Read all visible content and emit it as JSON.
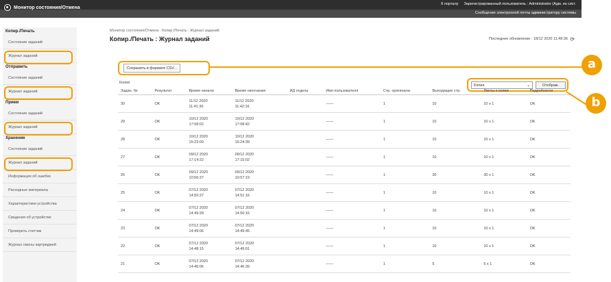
{
  "header": {
    "title": "Монитор состояния/Отмена",
    "links": [
      "К порталу",
      "Зарегистрированный пользователь : Administrator (Адм. из сист.",
      ""
    ],
    "mail_link": "Сообщение электронной почты администратору системы"
  },
  "sidebar": {
    "sections": [
      {
        "title": "Копир./Печать",
        "items": [
          {
            "label": "Состояние заданий",
            "highlight": false
          },
          {
            "label": "Журнал заданий",
            "highlight": true
          }
        ]
      },
      {
        "title": "Отправить",
        "items": [
          {
            "label": "Состояние заданий",
            "highlight": false
          },
          {
            "label": "Журнал заданий",
            "highlight": true
          }
        ]
      },
      {
        "title": "Прием",
        "items": [
          {
            "label": "Состояние заданий",
            "highlight": false
          },
          {
            "label": "Журнал заданий",
            "highlight": true
          }
        ]
      },
      {
        "title": "Хранение",
        "items": [
          {
            "label": "Состояние заданий",
            "highlight": false
          },
          {
            "label": "Журнал заданий",
            "highlight": true
          },
          {
            "label": "Информация об ошибке",
            "highlight": false
          },
          {
            "label": "Расходные материалы",
            "highlight": false
          },
          {
            "label": "Характеристики устройства",
            "highlight": false
          },
          {
            "label": "Сведения об устройстве",
            "highlight": false
          },
          {
            "label": "Проверить счетчик",
            "highlight": false
          },
          {
            "label": "Журнал смены картриджей",
            "highlight": false
          }
        ]
      }
    ]
  },
  "main": {
    "breadcrumb": "Монитор состояния/Отмена : Копир./Печать : Журнал заданий",
    "title": "Копир./Печать : Журнал заданий",
    "last_update": "Последнее обновление : 18/12 2020 11:49:36",
    "csv_button": "Сохранить в формате CSV...",
    "section_label": "Копия",
    "filter_value": "Копия",
    "display_button": "Отображ."
  },
  "table": {
    "columns": [
      "Задан. №",
      "Результат",
      "Время начала",
      "Время окончания",
      "ИД отдела",
      "Имя пользователя",
      "Стр. оригинала",
      "Выходящие стр.",
      "Листы x копии",
      "Подробности"
    ],
    "rows": [
      [
        "30",
        "OK",
        "11/12 2020\n11:41:36",
        "11/12 2020\n11:42:16",
        "",
        "——",
        "1",
        "10",
        "10 x 1",
        "OK"
      ],
      [
        "29",
        "OK",
        "10/12 2020\n17:08:02",
        "10/12 2020\n17:08:42",
        "",
        "——",
        "1",
        "10",
        "10 x 1",
        "OK"
      ],
      [
        "28",
        "OK",
        "10/12 2020\n15:23:00",
        "10/12 2020\n15:24:39",
        "",
        "——",
        "1",
        "10",
        "10 x 1",
        "OK"
      ],
      [
        "27",
        "OK",
        "09/12 2020\n17:14:22",
        "09/12 2020\n17:15:02",
        "",
        "——",
        "1",
        "10",
        "10 x 1",
        "OK"
      ],
      [
        "26",
        "OK",
        "09/12 2020\n10:56:37",
        "09/12 2020\n10:57:19",
        "",
        "——",
        "1",
        "30",
        "30 x 1",
        "OK"
      ],
      [
        "25",
        "OK",
        "07/12 2020\n14:50:37",
        "07/12 2020\n14:51:16",
        "",
        "——",
        "1",
        "10",
        "10 x 1",
        "OK"
      ],
      [
        "24",
        "OK",
        "07/12 2020\n14:49:28",
        "07/12 2020\n14:50:16",
        "",
        "——",
        "1",
        "10",
        "10 x 1",
        "OK"
      ],
      [
        "23",
        "OK",
        "07/12 2020\n14:49:06",
        "07/12 2020\n14:49:45",
        "",
        "——",
        "1",
        "10",
        "10 x 1",
        "OK"
      ],
      [
        "22",
        "OK",
        "07/12 2020\n14:48:15",
        "07/12 2020\n14:49:01",
        "",
        "——",
        "1",
        "10",
        "10 x 1",
        "OK"
      ],
      [
        "21",
        "OK",
        "07/12 2020\n14:46:06",
        "07/12 2020\n14:46:39",
        "",
        "——",
        "1",
        "5",
        "5 x 1",
        "OK"
      ]
    ]
  },
  "callouts": {
    "a": "a",
    "b": "b"
  },
  "colors": {
    "accent": "#f0a000",
    "topbar": "#4a4a4a"
  }
}
